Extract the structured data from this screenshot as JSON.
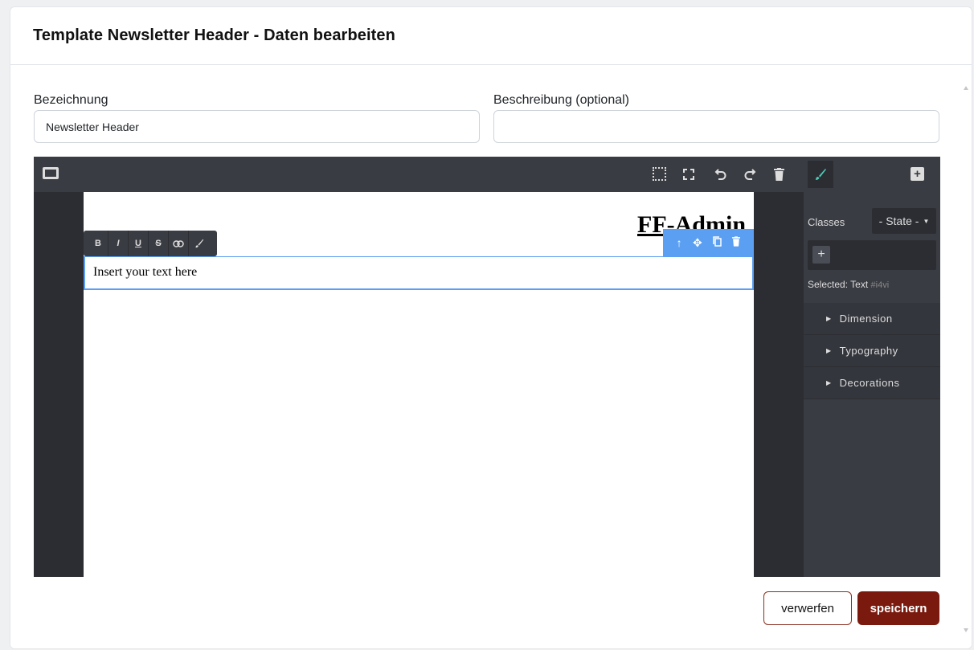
{
  "dialog": {
    "title": "Template Newsletter Header - Daten bearbeiten"
  },
  "form": {
    "name_label": "Bezeichnung",
    "name_value": "Newsletter Header",
    "description_label": "Beschreibung (optional)",
    "description_value": ""
  },
  "editor": {
    "toolbar_icons": [
      "device-desktop-icon",
      "sw-visibility-icon",
      "fullscreen-icon",
      "undo-icon",
      "redo-icon",
      "trash-icon"
    ],
    "side_tabs": [
      "style-manager-brush-icon",
      "block-manager-plus-icon"
    ],
    "canvas": {
      "title": "FF-Admin",
      "text_block": "Insert your text here",
      "rte_buttons": [
        "B",
        "I",
        "U",
        "S"
      ],
      "rte_icons": [
        "link-icon",
        "brush-icon"
      ],
      "badge_icons": [
        "arrow-up-icon",
        "move-icon",
        "copy-icon",
        "trash-icon"
      ]
    },
    "style_manager": {
      "classes_label": "Classes",
      "state_label": "- State -",
      "add_class": "+",
      "selected_prefix": "Selected:",
      "selected_name": "Text",
      "selected_id": "#i4vi",
      "sectors": [
        "Dimension",
        "Typography",
        "Decorations"
      ]
    },
    "colors": {
      "accent": "#5a9ff1",
      "panel": "#3a3c43",
      "panel_dark": "#2b2d33",
      "brush": "#50c8b4"
    }
  },
  "footer": {
    "cancel_label": "verwerfen",
    "save_label": "speichern",
    "save_color": "#7a1a0e"
  }
}
